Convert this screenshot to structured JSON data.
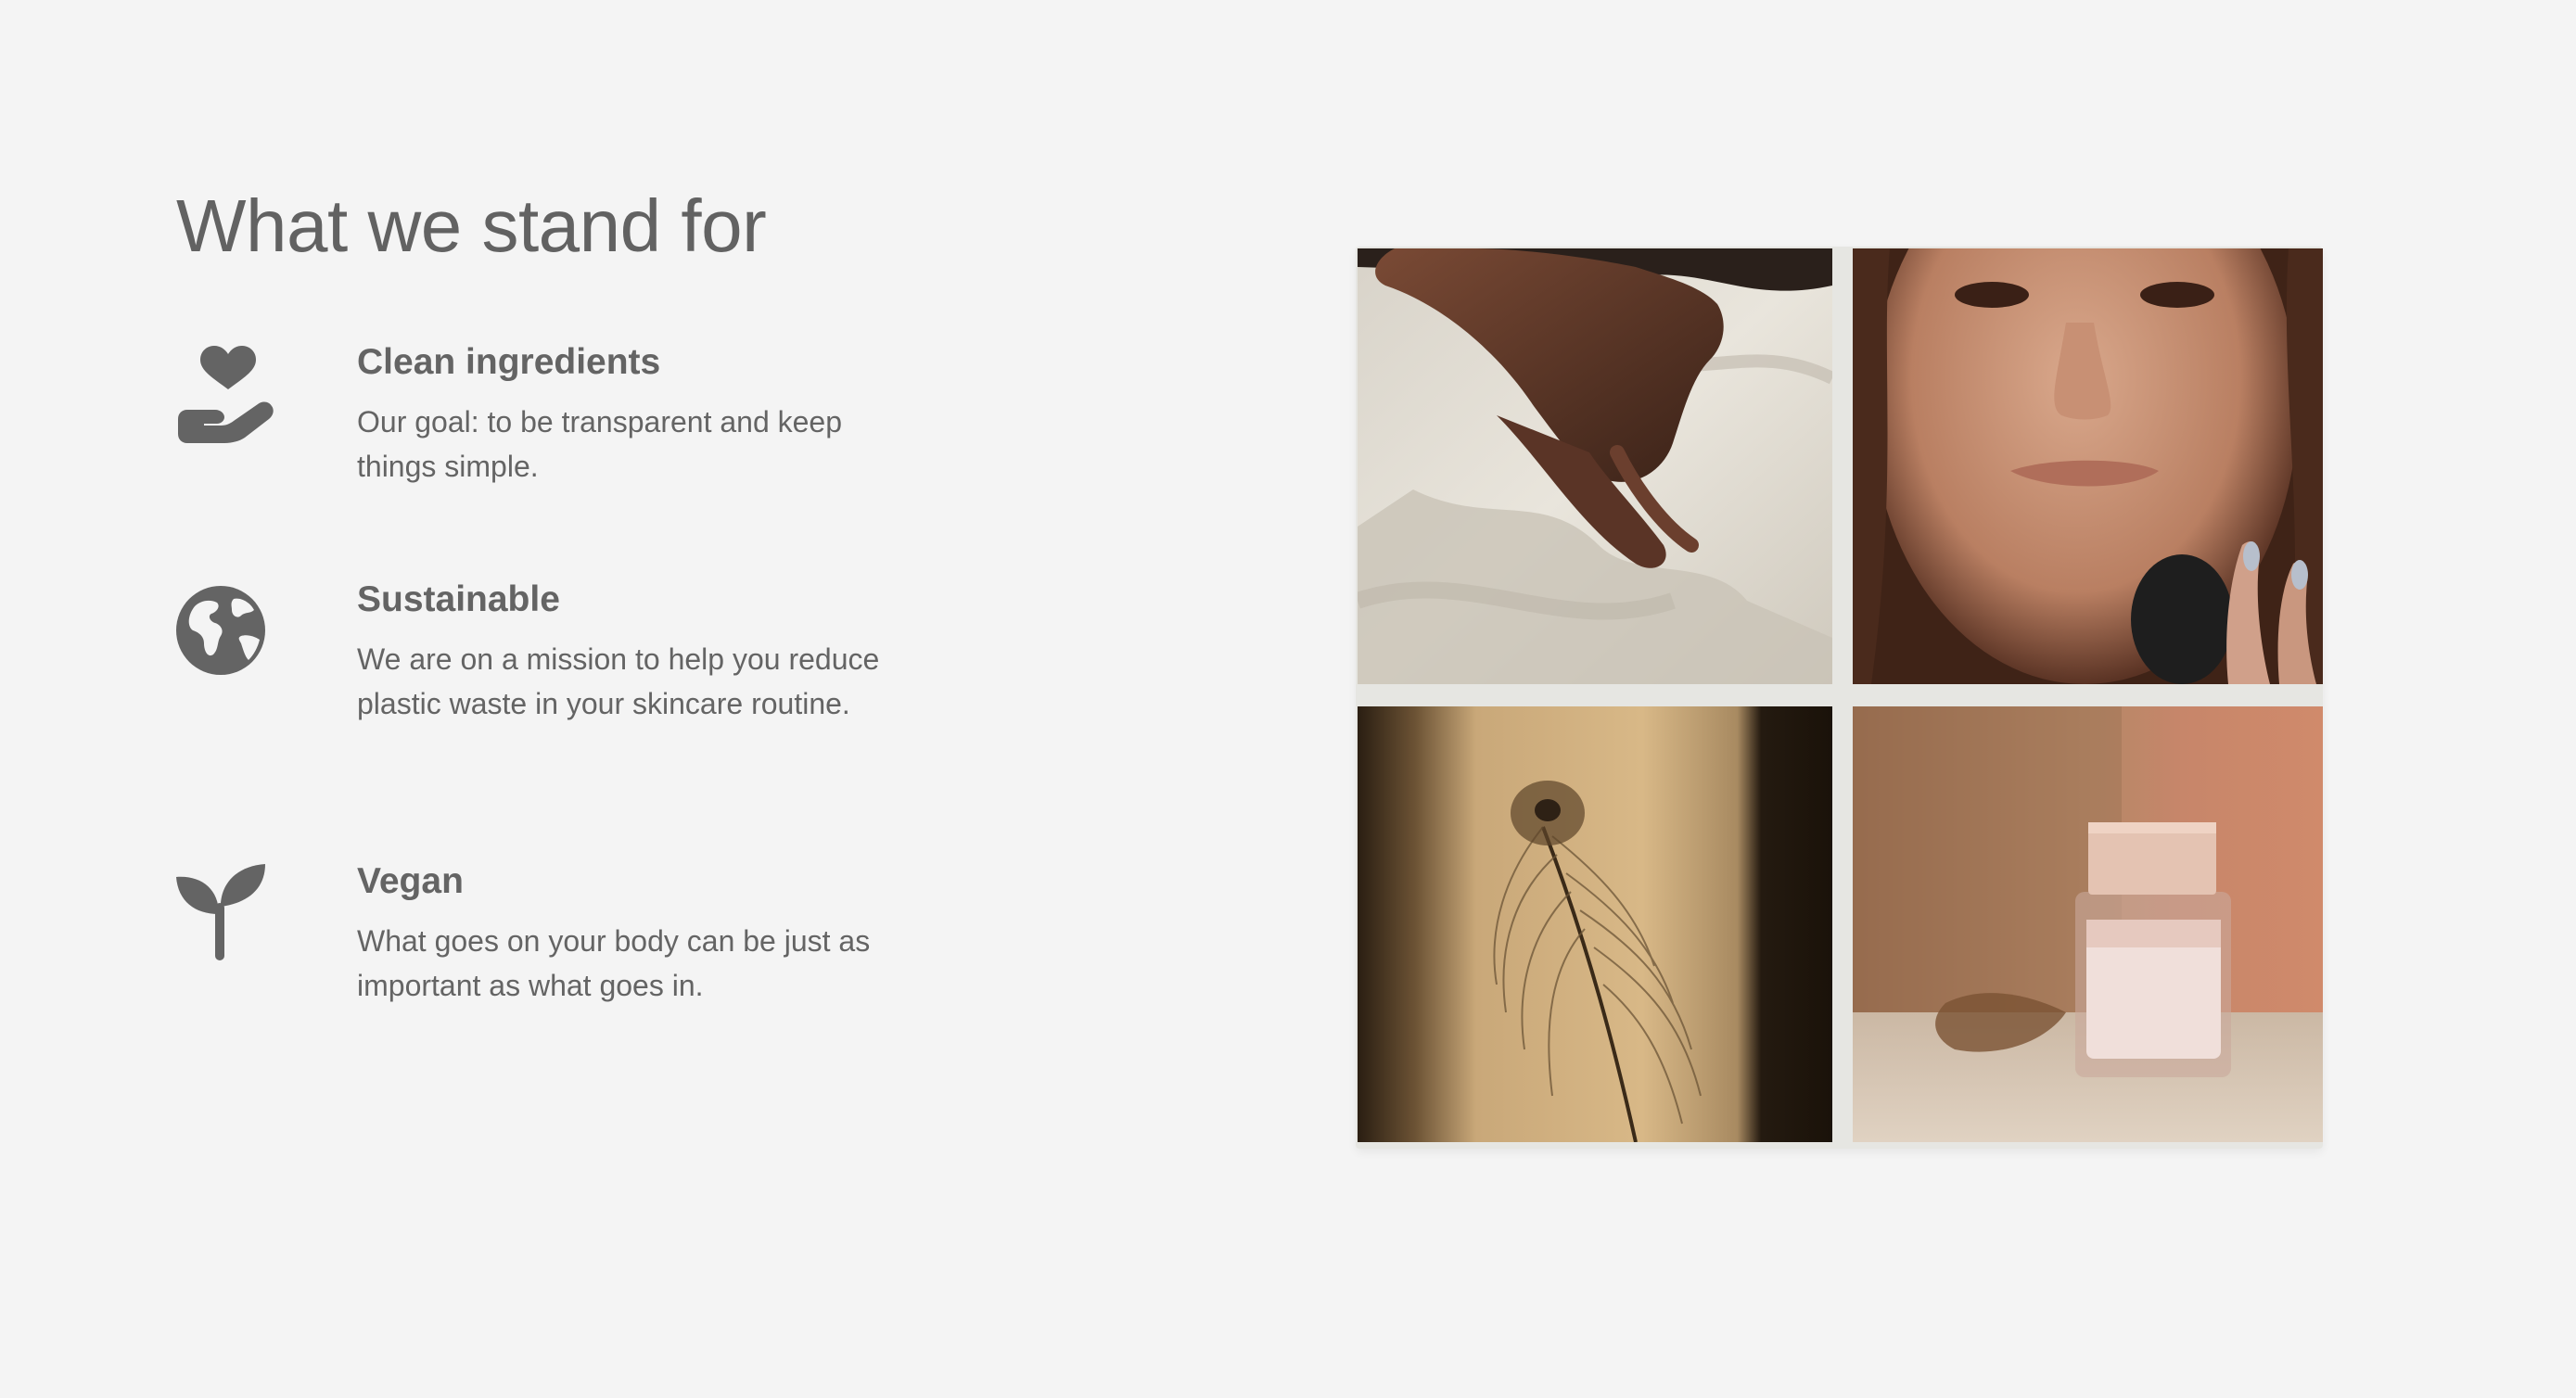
{
  "section": {
    "heading": "What we stand for"
  },
  "features": [
    {
      "icon": "hand-holding-heart-icon",
      "title": "Clean ingredients",
      "description": "Our goal: to be transparent and keep things simple."
    },
    {
      "icon": "globe-icon",
      "title": "Sustainable",
      "description": "We are on a mission to help you reduce plastic waste in your skincare routine."
    },
    {
      "icon": "seedling-icon",
      "title": "Vegan",
      "description": "What goes on your body can be just as important as what goes in."
    }
  ],
  "gallery": {
    "images": [
      {
        "subject": "hands on linen"
      },
      {
        "subject": "woman's face"
      },
      {
        "subject": "feather in shadow"
      },
      {
        "subject": "cream jar"
      }
    ]
  },
  "colors": {
    "background": "#f4f4f4",
    "text": "#646464",
    "icon": "#646464"
  }
}
